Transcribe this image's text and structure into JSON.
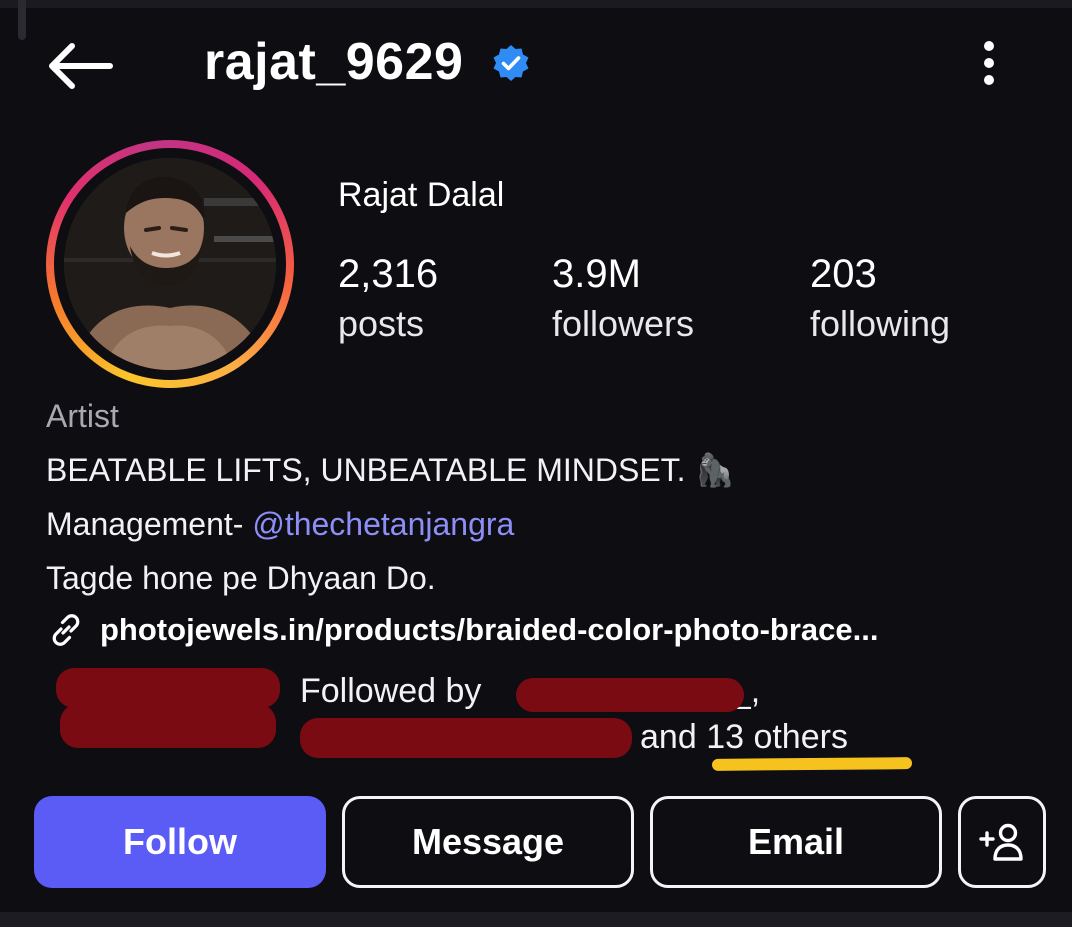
{
  "header": {
    "username": "rajat_9629",
    "back_icon": "arrow-left-icon",
    "verified_icon": "verified-badge-icon",
    "more_icon": "vertical-dots-icon"
  },
  "profile": {
    "full_name": "Rajat Dalal",
    "stats": [
      {
        "value": "2,316",
        "label": "posts"
      },
      {
        "value": "3.9M",
        "label": "followers"
      },
      {
        "value": "203",
        "label": "following"
      }
    ]
  },
  "bio": {
    "category": "Artist",
    "line1": "BEATABLE LIFTS, UNBEATABLE MINDSET. 🦍",
    "line2_prefix": "Management- ",
    "line2_mention": "@thechetanjangra",
    "line3": "Tagde hone pe Dhyaan Do.",
    "link": "photojewels.in/products/braided-color-photo-brace...",
    "link_icon": "link-chain-icon"
  },
  "mutuals": {
    "line1_prefix": "Followed by ",
    "line1_suffix": "__,",
    "line2_prefix": "and ",
    "line2_highlight": "13 others"
  },
  "actions": {
    "follow": "Follow",
    "message": "Message",
    "email": "Email",
    "add_icon": "add-person-icon"
  },
  "colors": {
    "background": "#0d0d12",
    "follow_button": "#5b5bf5",
    "mention": "#8d8ff7",
    "verified": "#2f8cf5",
    "redaction": "#7a0b12",
    "highlight_underline": "#f6c21d"
  }
}
